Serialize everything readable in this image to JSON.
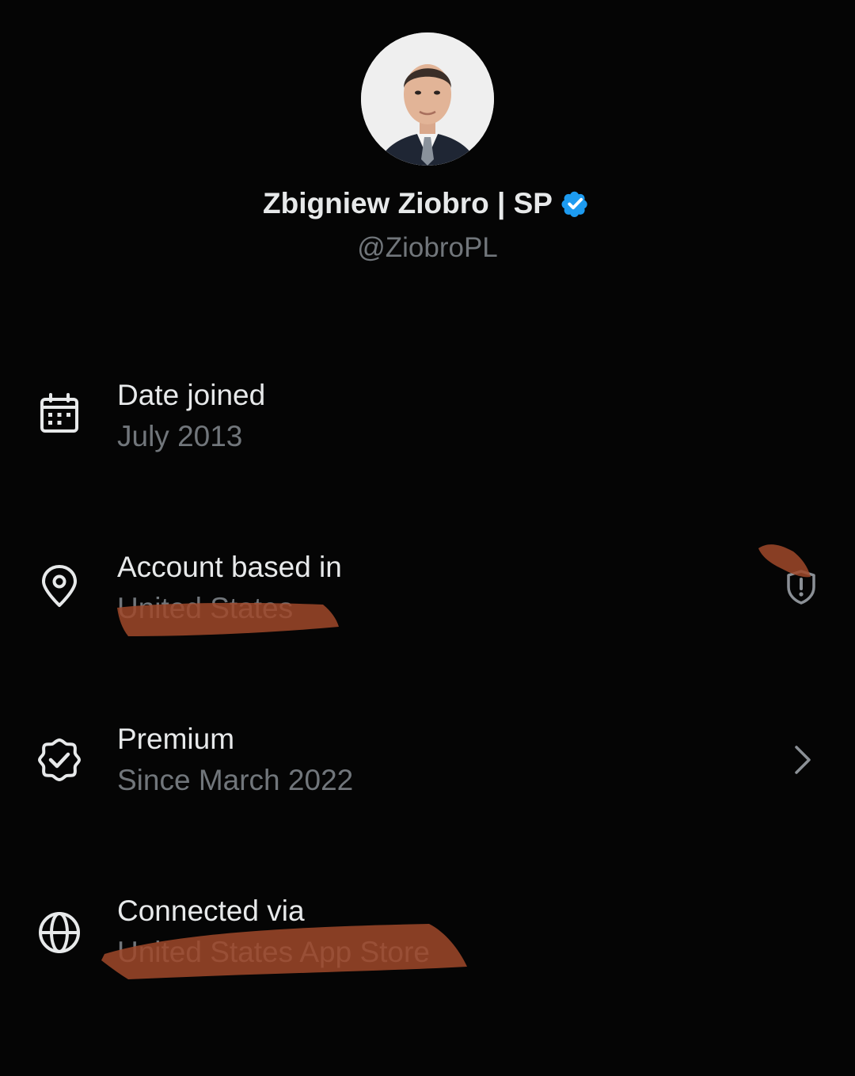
{
  "profile": {
    "display_name": "Zbigniew Ziobro | SP",
    "handle": "@ZiobroPL",
    "verified_icon": "verified-badge-icon",
    "verified_color": "#1d9bf0"
  },
  "rows": [
    {
      "icon": "calendar-icon",
      "title": "Date joined",
      "value": "July 2013"
    },
    {
      "icon": "location-pin-icon",
      "title": "Account based in",
      "value": "United States",
      "right_icon": "shield-alert-icon"
    },
    {
      "icon": "premium-badge-icon",
      "title": "Premium",
      "value": "Since March 2022",
      "right_icon": "chevron-right-icon"
    },
    {
      "icon": "globe-icon",
      "title": "Connected via",
      "value": "United States App Store"
    }
  ],
  "colors": {
    "background": "#050505",
    "primary_text": "#e7e9ea",
    "secondary_text": "#71767b",
    "annotation_marker": "#a0492a"
  }
}
